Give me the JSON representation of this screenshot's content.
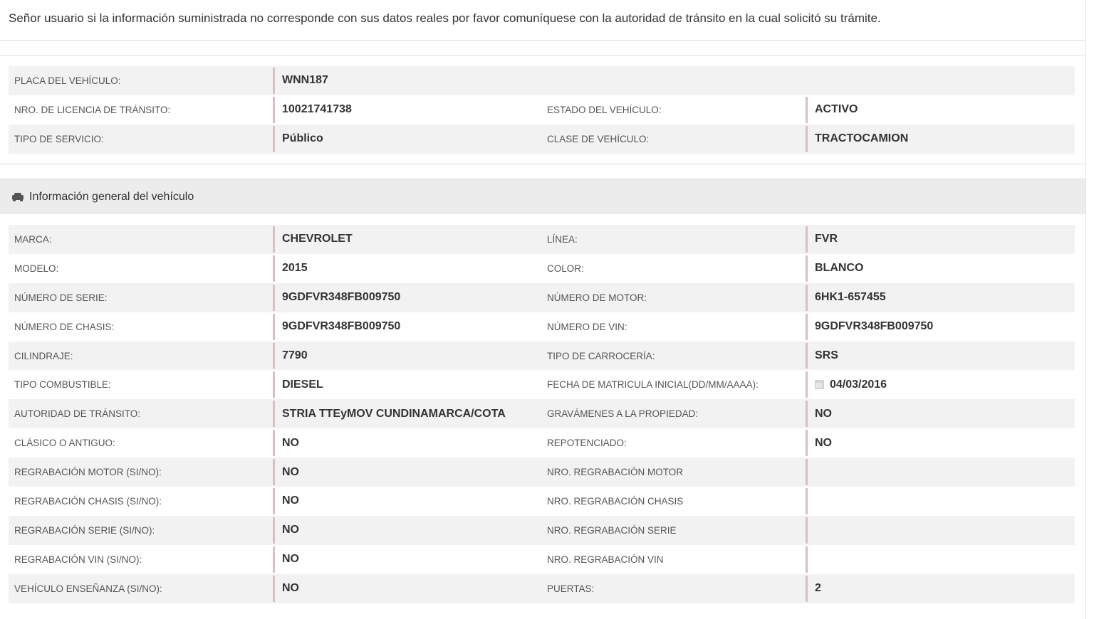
{
  "notice": "Señor usuario si la información suministrada no corresponde con sus datos reales por favor comuníquese con la autoridad de tránsito en la cual solicitó su trámite.",
  "summary": {
    "rows": [
      {
        "label1": "PLACA DEL VEHÍCULO:",
        "value1": "WNN187",
        "label2": "",
        "value2": ""
      },
      {
        "label1": "NRO. DE LICENCIA DE TRÁNSITO:",
        "value1": "10021741738",
        "label2": "ESTADO DEL VEHÍCULO:",
        "value2": "ACTIVO"
      },
      {
        "label1": "TIPO DE SERVICIO:",
        "value1": "Público",
        "label2": "CLASE DE VEHÍCULO:",
        "value2": "TRACTOCAMION"
      }
    ]
  },
  "general": {
    "title": "Información general del vehículo",
    "icon": "car-icon",
    "rows": [
      {
        "label1": "MARCA:",
        "value1": "CHEVROLET",
        "label2": "LÍNEA:",
        "value2": "FVR"
      },
      {
        "label1": "MODELO:",
        "value1": "2015",
        "label2": "COLOR:",
        "value2": "BLANCO"
      },
      {
        "label1": "NÚMERO DE SERIE:",
        "value1": "9GDFVR348FB009750",
        "label2": "NÚMERO DE MOTOR:",
        "value2": "6HK1-657455"
      },
      {
        "label1": "NÚMERO DE CHASIS:",
        "value1": "9GDFVR348FB009750",
        "label2": "NÚMERO DE VIN:",
        "value2": "9GDFVR348FB009750"
      },
      {
        "label1": "CILINDRAJE:",
        "value1": "7790",
        "label2": "TIPO DE CARROCERÍA:",
        "value2": "SRS"
      },
      {
        "label1": "TIPO COMBUSTIBLE:",
        "value1": "DIESEL",
        "label2": "FECHA DE MATRICULA INICIAL(DD/MM/AAAA):",
        "value2": "04/03/2016"
      },
      {
        "label1": "AUTORIDAD DE TRÁNSITO:",
        "value1": "STRIA TTEyMOV CUNDINAMARCA/COTA",
        "label2": "GRAVÁMENES A LA PROPIEDAD:",
        "value2": "NO"
      },
      {
        "label1": "CLÁSICO O ANTIGUO:",
        "value1": "NO",
        "label2": "REPOTENCIADO:",
        "value2": "NO"
      },
      {
        "label1": "REGRABACIÓN MOTOR (SI/NO):",
        "value1": "NO",
        "label2": "NRO. REGRABACIÓN MOTOR",
        "value2": ""
      },
      {
        "label1": "REGRABACIÓN CHASIS (SI/NO):",
        "value1": "NO",
        "label2": "NRO. REGRABACIÓN CHASIS",
        "value2": ""
      },
      {
        "label1": "REGRABACIÓN SERIE (SI/NO):",
        "value1": "NO",
        "label2": "NRO. REGRABACIÓN SERIE",
        "value2": ""
      },
      {
        "label1": "REGRABACIÓN VIN (SI/NO):",
        "value1": "NO",
        "label2": "NRO. REGRABACIÓN VIN",
        "value2": ""
      },
      {
        "label1": "VEHÍCULO ENSEÑANZA (SI/NO):",
        "value1": "NO",
        "label2": "PUERTAS:",
        "value2": "2"
      }
    ]
  },
  "colors": {
    "accent_border": "#d8c0c0",
    "row_stripe": "#f2f2f2",
    "header_bg": "#ececec"
  }
}
